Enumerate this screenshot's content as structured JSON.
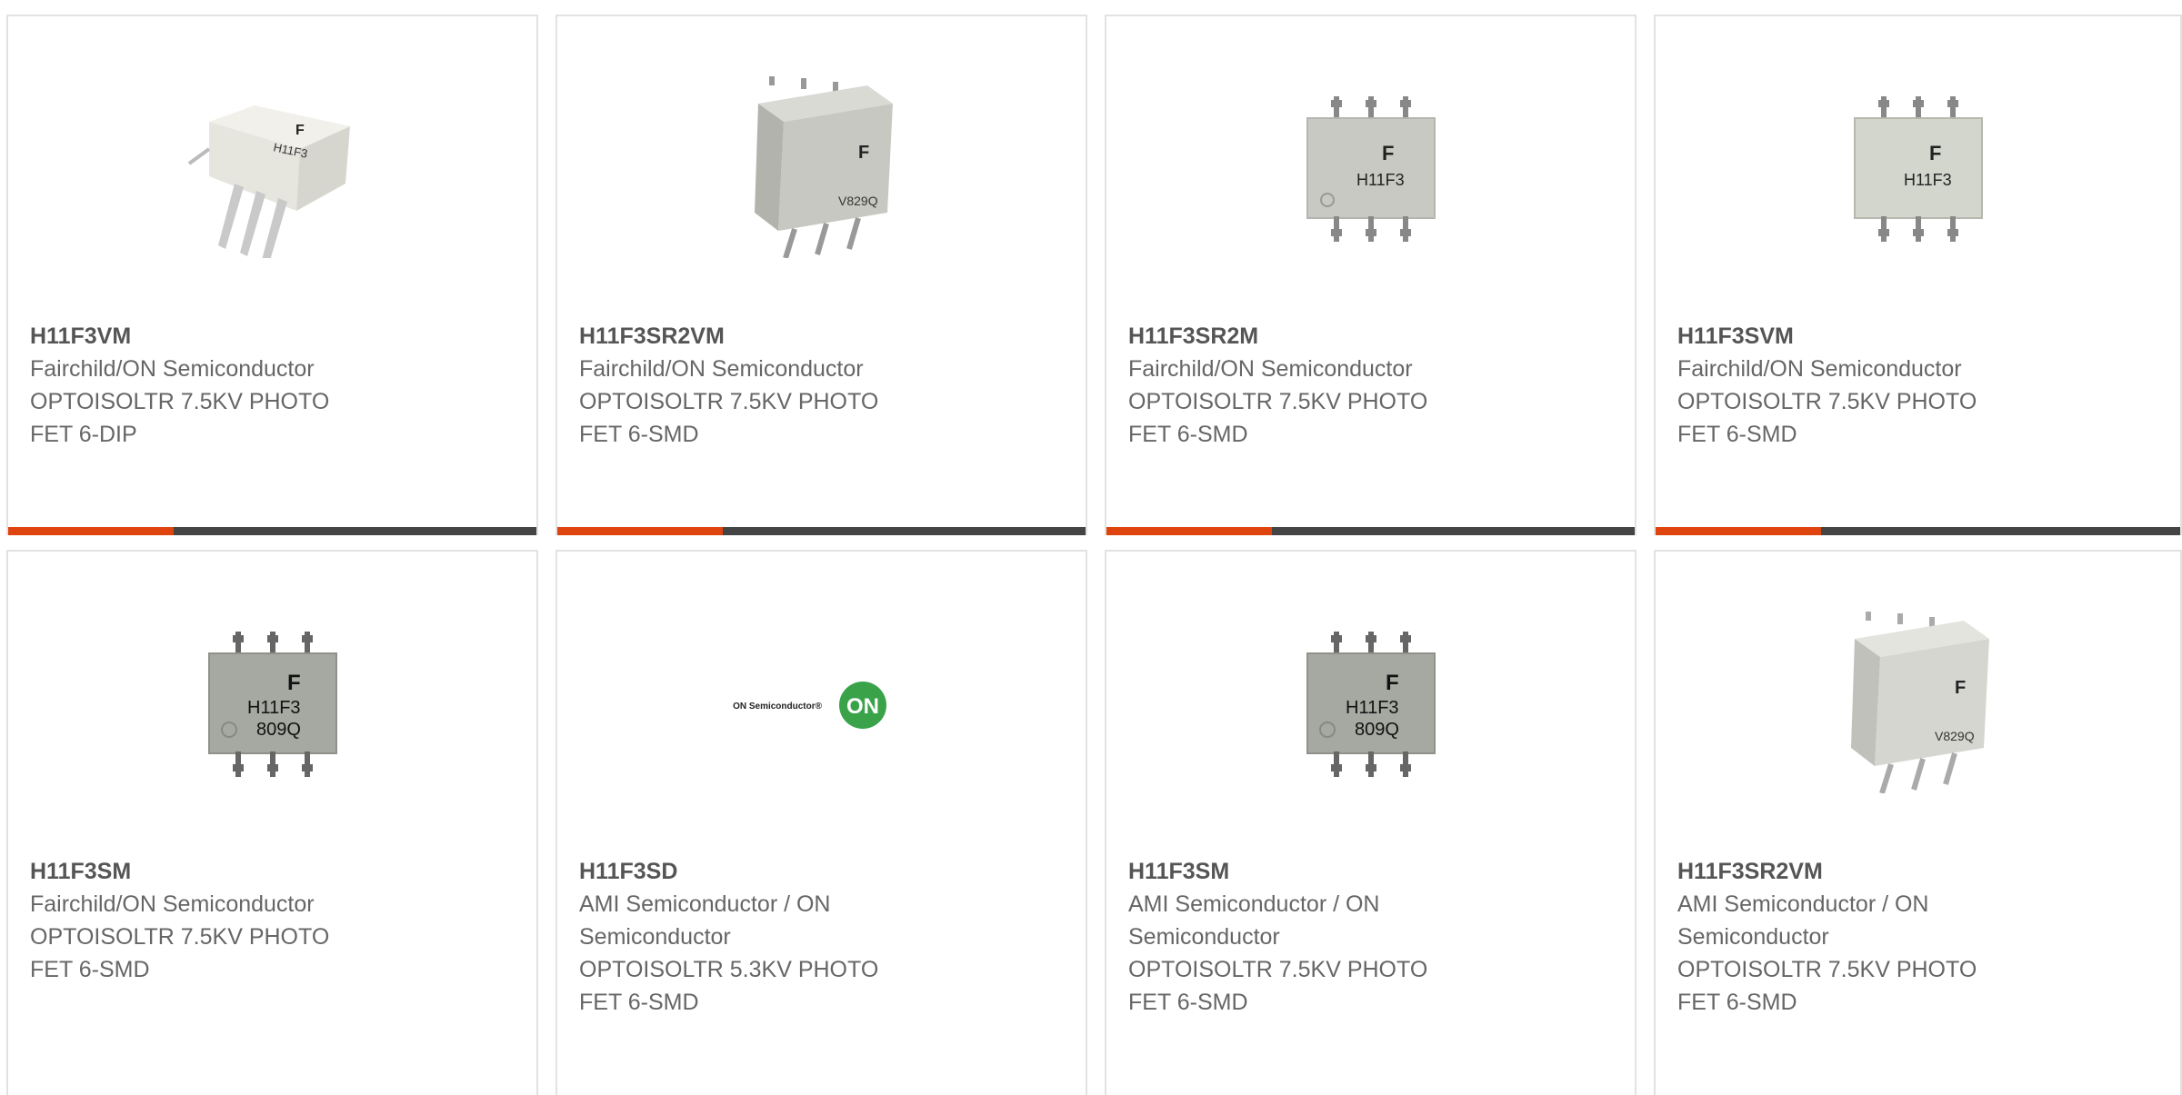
{
  "products": [
    {
      "part": "H11F3VM",
      "maker": "Fairchild/ON Semiconductor",
      "desc1": "OPTOISOLTR 7.5KV PHOTO",
      "desc2": "FET 6-DIP",
      "image": "dip6-angled-component",
      "marking": "H11F3"
    },
    {
      "part": "H11F3SR2VM",
      "maker": "Fairchild/ON Semiconductor",
      "desc1": "OPTOISOLTR 7.5KV PHOTO",
      "desc2": "FET 6-SMD",
      "image": "smd6-angled-component",
      "marking": "V829Q"
    },
    {
      "part": "H11F3SR2M",
      "maker": "Fairchild/ON Semiconductor",
      "desc1": "OPTOISOLTR 7.5KV PHOTO",
      "desc2": "FET 6-SMD",
      "image": "smd6-top-component",
      "marking": "H11F3"
    },
    {
      "part": "H11F3SVM",
      "maker": "Fairchild/ON Semiconductor",
      "desc1": "OPTOISOLTR 7.5KV PHOTO",
      "desc2": "FET 6-SMD",
      "image": "smd6-top-component",
      "marking": "H11F3"
    },
    {
      "part": "H11F3SM",
      "maker": "Fairchild/ON Semiconductor",
      "desc1": "OPTOISOLTR 7.5KV PHOTO",
      "desc2": "FET 6-SMD",
      "image": "smd6-top-dark-component",
      "marking": "H11F3",
      "marking2": "809Q"
    },
    {
      "part": "H11F3SD",
      "maker": "AMI Semiconductor / ON",
      "maker2": "Semiconductor",
      "desc1": "OPTOISOLTR 5.3KV PHOTO",
      "desc2": "FET 6-SMD",
      "image": "on-semiconductor-logo",
      "logo_text": "ON Semiconductor®",
      "logo_badge": "ON"
    },
    {
      "part": "H11F3SM",
      "maker": "AMI Semiconductor / ON",
      "maker2": "Semiconductor",
      "desc1": "OPTOISOLTR 7.5KV PHOTO",
      "desc2": "FET 6-SMD",
      "image": "smd6-top-dark-component",
      "marking": "H11F3",
      "marking2": "809Q"
    },
    {
      "part": "H11F3SR2VM",
      "maker": "AMI Semiconductor / ON",
      "maker2": "Semiconductor",
      "desc1": "OPTOISOLTR 7.5KV PHOTO",
      "desc2": "FET 6-SMD",
      "image": "smd6-angled-component",
      "marking": "V829Q"
    }
  ],
  "colors": {
    "accent": "#e0440e",
    "bar": "#444444",
    "border": "#e2e2e2",
    "title": "#555555",
    "text": "#666666"
  }
}
